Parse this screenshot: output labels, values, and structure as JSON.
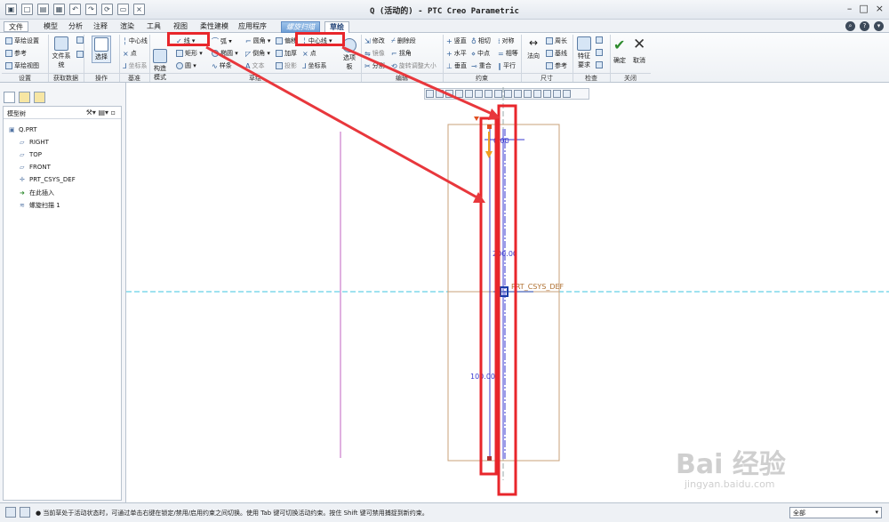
{
  "window": {
    "title": "Q (活动的) - PTC Creo Parametric"
  },
  "menu": {
    "file": "文件",
    "tabs": [
      "模型",
      "分析",
      "注释",
      "渲染",
      "工具",
      "视图",
      "柔性建模",
      "应用程序"
    ],
    "context_tab": "螺旋扫描",
    "active_tab": "草绘"
  },
  "ribbon": {
    "setup": {
      "sketch_setup": "草绘设置",
      "references": "参考",
      "sketch_view": "草绘视图",
      "group": "设置"
    },
    "get_data": {
      "file_system": "文件系统",
      "group": "获取数据"
    },
    "operations": {
      "select": "选择",
      "group": "操作"
    },
    "datum": {
      "centerline": "中心线",
      "point": "点",
      "coord_sys": "坐标系",
      "group": "基准"
    },
    "sketch": {
      "construction_mode": "构造模式",
      "line": "线",
      "rectangle": "矩形",
      "circle": "圆",
      "arc": "弧",
      "ellipse": "椭圆",
      "spline": "样条",
      "fillet": "圆角",
      "chamfer": "倒角",
      "text": "文本",
      "offset": "偏移",
      "thicken": "加厚",
      "project": "投影",
      "centerline": "中心线",
      "point": "点",
      "coord_sys": "坐标系",
      "palette": "选项板",
      "group": "草绘"
    },
    "editing": {
      "modify": "修改",
      "mirror": "镜像",
      "divide": "分割",
      "delete_segment": "删除段",
      "corner": "拐角",
      "rotate_resize": "旋转调整大小",
      "group": "编辑"
    },
    "constrain": {
      "vertical": "竖直",
      "horizontal": "水平",
      "perpendicular": "垂直",
      "tangent": "相切",
      "midpoint": "中点",
      "coincident": "重合",
      "symmetric": "对称",
      "equal": "相等",
      "parallel": "平行",
      "group": "约束"
    },
    "dimension": {
      "normal": "法向",
      "perimeter": "周长",
      "baseline": "基线",
      "reference": "参考",
      "group": "尺寸"
    },
    "inspect": {
      "feature_req": "特征要求",
      "group": "检查"
    },
    "close": {
      "ok": "确定",
      "cancel": "取消",
      "group": "关闭"
    }
  },
  "model_tree": {
    "title": "模型树",
    "items": [
      "Q.PRT",
      "RIGHT",
      "TOP",
      "FRONT",
      "PRT_CSYS_DEF",
      "在此插入",
      "螺旋扫描 1"
    ]
  },
  "canvas": {
    "dimensions": [
      "0.00",
      "200.00",
      "100.00"
    ],
    "csys_label": "PRT_CSYS_DEF"
  },
  "status": {
    "message": "● 当前草处于活动状态时，可通过单击右键在锁定/禁用/启用约束之间切换。使用 Tab 键可切换活动约束。按住 Shift 键可禁用捕捉到新约束。",
    "filter": "全部"
  },
  "watermark": {
    "brand": "Bai 经验",
    "url": "jingyan.baidu.com"
  },
  "colors": {
    "highlight": "#e8262b",
    "sketch": "#3a3ad0",
    "dashed_axis": "#3fc4e0",
    "part_outline": "#c8a07a",
    "arrow": "#e8373c"
  }
}
